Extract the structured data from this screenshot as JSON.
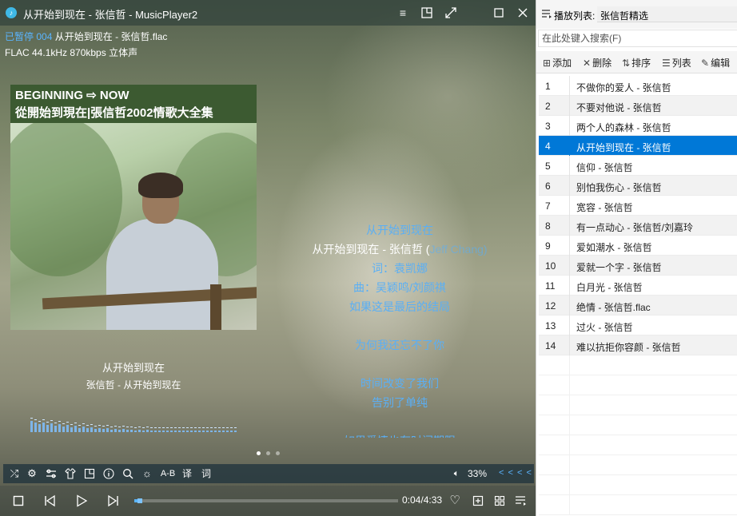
{
  "window": {
    "title": "从开始到现在 - 张信哲 - MusicPlayer2",
    "app_icon": "music-note-icon",
    "controls": [
      "menu-icon",
      "mini-mode-icon",
      "fullscreen-icon",
      "maximize-icon",
      "close-icon"
    ]
  },
  "status": {
    "state": "已暂停",
    "index": "004",
    "file": "从开始到现在 - 张信哲.flac",
    "format_info": "FLAC 44.1kHz 870kbps 立体声"
  },
  "album_art": {
    "line1": "BEGINNING ⇨ NOW",
    "line2": "從開始到現在|張信哲2002情歌大全集"
  },
  "now_playing": {
    "title": "从开始到现在",
    "subtitle": "张信哲 - 从开始到现在"
  },
  "lyrics": {
    "lines": [
      {
        "text": "从开始到现在",
        "current": false
      },
      {
        "text": "从开始到现在 - 张信哲 (",
        "extra": "Jeff Chang)",
        "current": true
      },
      {
        "text": "词：袁凯娜",
        "current": false
      },
      {
        "text": "曲：吴颖鸣/刘颜祺",
        "current": false
      },
      {
        "text": "如果这是最后的结局",
        "current": false
      },
      {
        "text": "",
        "current": false
      },
      {
        "text": "为何我还忘不了你",
        "current": false
      },
      {
        "text": "",
        "current": false
      },
      {
        "text": "时间改变了我们",
        "current": false
      },
      {
        "text": "告别了单纯",
        "current": false
      },
      {
        "text": "",
        "current": false
      },
      {
        "text": "如果爱情也有时间期限",
        "current": false
      }
    ]
  },
  "toolbar": {
    "ab_label": "A-B",
    "translate_label": "译",
    "lyric_label": "词",
    "volume": "33%",
    "volume_arrows": "< < < <"
  },
  "transport": {
    "time": "0:04/4:33",
    "progress": 0.0147
  },
  "spectrum": [
    14,
    12,
    10,
    12,
    9,
    11,
    8,
    10,
    7,
    9,
    6,
    8,
    5,
    7,
    5,
    6,
    4,
    5,
    4,
    5,
    3,
    4,
    3,
    4,
    3,
    3,
    2,
    3,
    2,
    3,
    2,
    2,
    2,
    2,
    2,
    2,
    2,
    2,
    2,
    2,
    2,
    2,
    2,
    2,
    2,
    2,
    2,
    2,
    2,
    2,
    2,
    2
  ],
  "playlist": {
    "header_label": "播放列表:",
    "name": "张信哲精选",
    "search_placeholder": "在此处键入搜索(F)",
    "tools": {
      "add": "添加",
      "delete": "删除",
      "sort": "排序",
      "list": "列表",
      "edit": "编辑"
    },
    "tracks": [
      {
        "num": "1",
        "name": "不做你的爱人 - 张信哲"
      },
      {
        "num": "2",
        "name": "不要对他说 - 张信哲"
      },
      {
        "num": "3",
        "name": "两个人的森林 - 张信哲"
      },
      {
        "num": "4",
        "name": "从开始到现在 - 张信哲"
      },
      {
        "num": "5",
        "name": "信仰 - 张信哲"
      },
      {
        "num": "6",
        "name": "别怕我伤心 - 张信哲"
      },
      {
        "num": "7",
        "name": "宽容 - 张信哲"
      },
      {
        "num": "8",
        "name": "有一点动心 - 张信哲/刘嘉玲"
      },
      {
        "num": "9",
        "name": "爱如潮水 - 张信哲"
      },
      {
        "num": "10",
        "name": "爱就一个字 - 张信哲"
      },
      {
        "num": "11",
        "name": "白月光 - 张信哲"
      },
      {
        "num": "12",
        "name": "绝情 - 张信哲.flac"
      },
      {
        "num": "13",
        "name": "过火 - 张信哲"
      },
      {
        "num": "14",
        "name": "难以抗拒你容颜 - 张信哲"
      }
    ],
    "selected_index": 3
  },
  "colors": {
    "accent": "#0078d7",
    "lyric_blue": "#5aaff5",
    "status_blue": "#5ab4ff"
  }
}
